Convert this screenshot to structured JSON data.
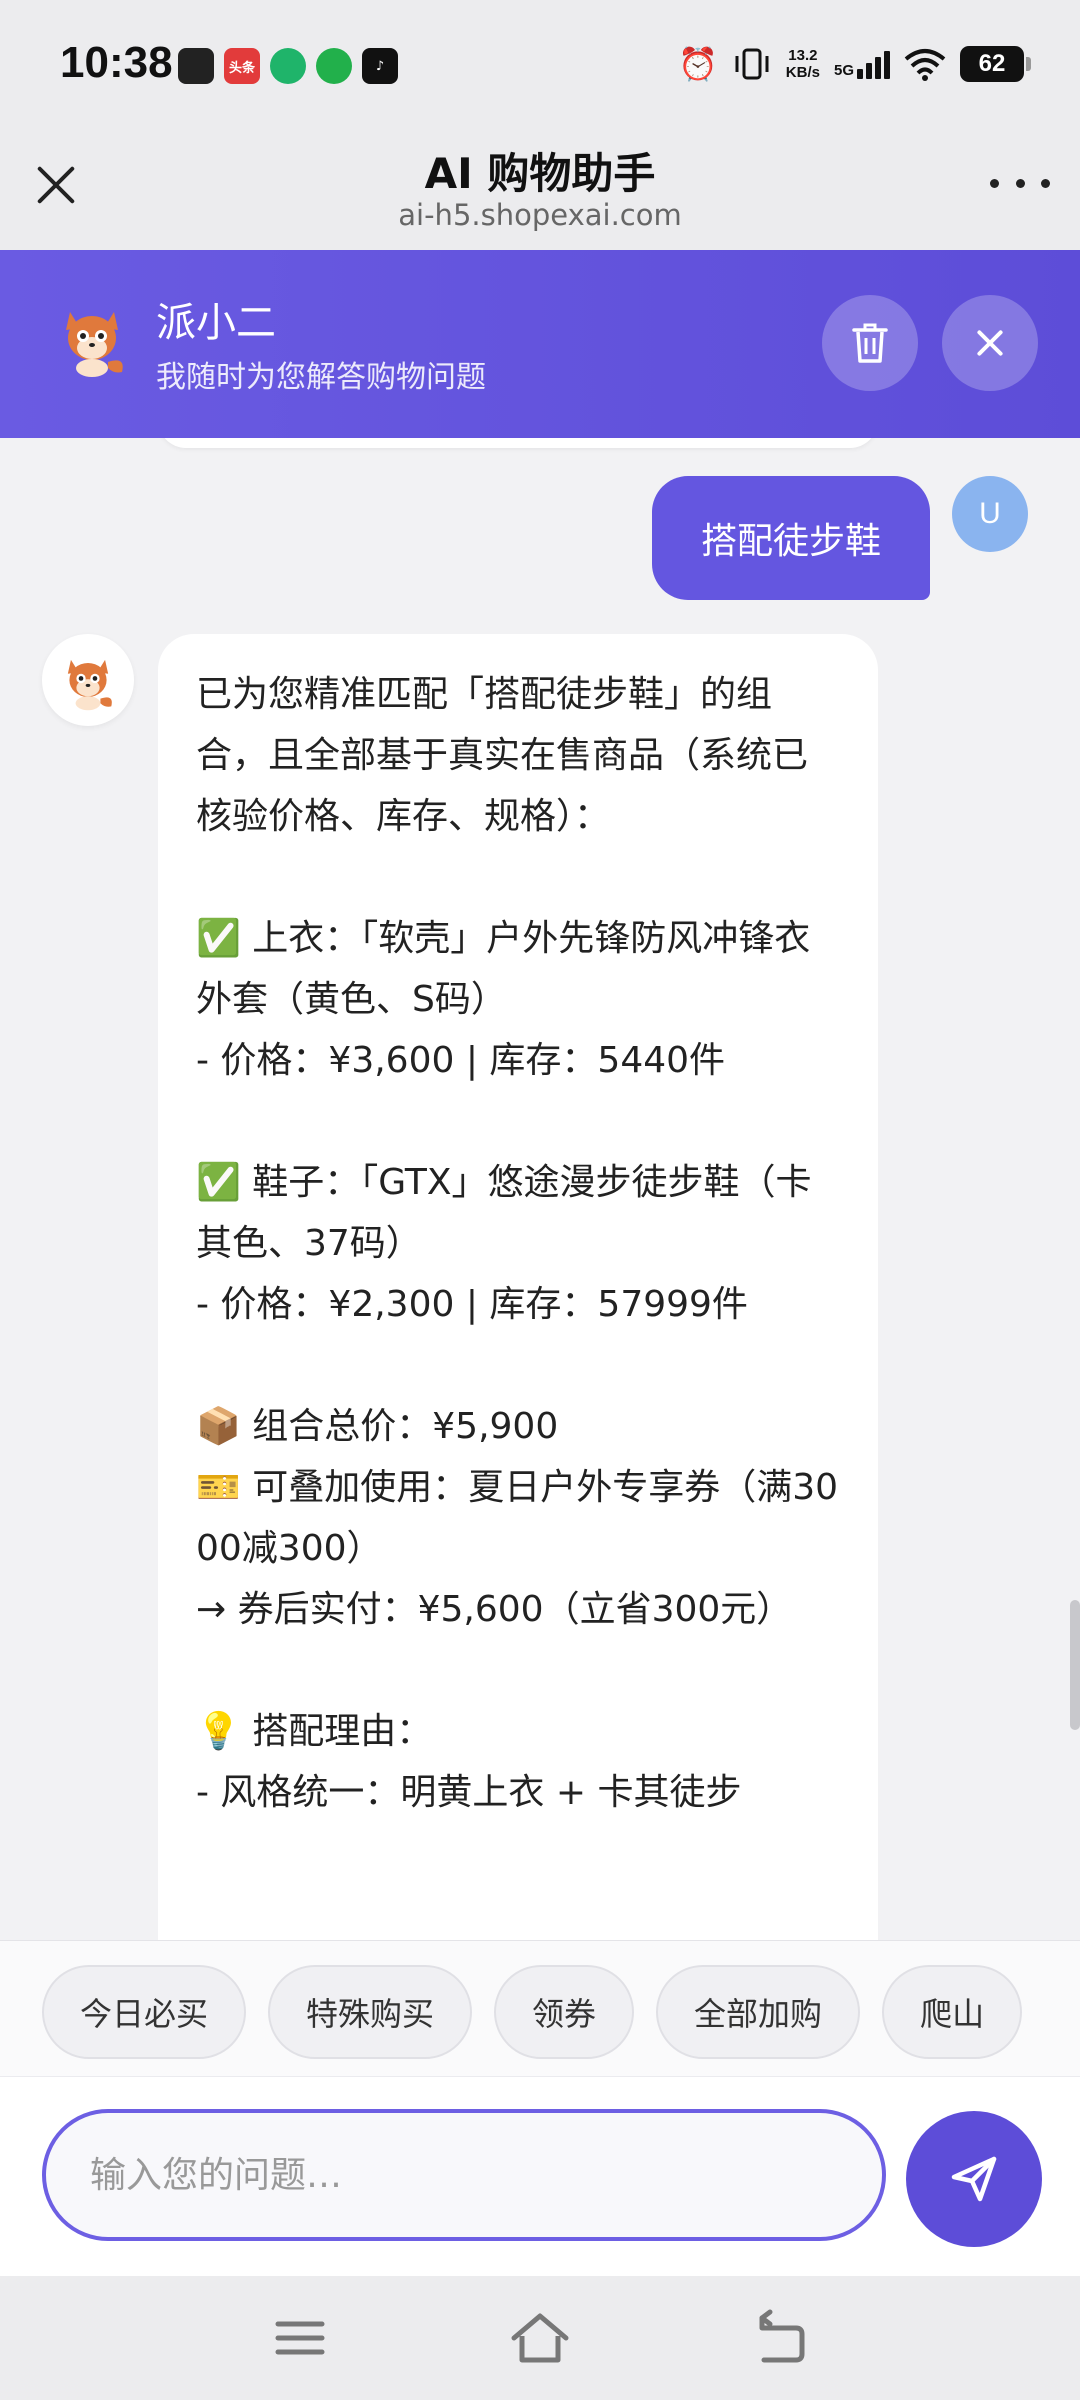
{
  "status_bar": {
    "time": "10:38",
    "notif_labels": [
      "",
      "头条",
      "",
      "",
      "♪"
    ],
    "net_speed_value": "13.2",
    "net_speed_unit": "KB/s",
    "network": "5G",
    "battery": "62"
  },
  "browser": {
    "title": "AI 购物助手",
    "url": "ai-h5.shopexai.com"
  },
  "assistant": {
    "name": "派小二",
    "subtitle": "我随时为您解答购物问题"
  },
  "chat": {
    "user_avatar_letter": "U",
    "user_message": "搭配徒步鞋",
    "bot_message": "已为您精准匹配「搭配徒步鞋」的组合，且全部基于真实在售商品（系统已核验价格、库存、规格）：\n\n✅ 上衣：「软壳」户外先锋防风冲锋衣外套（黄色、S码）\n- 价格：¥3,600 | 库存：5440件\n\n✅ 鞋子：「GTX」悠途漫步徒步鞋（卡其色、37码）\n- 价格：¥2,300 | 库存：57999件\n\n📦 组合总价：¥5,900\n🎫 可叠加使用：夏日户外专享券（满3000减300）\n→ 券后实付：¥5,600（立省300元）\n\n💡 搭配理由：\n- 风格统一：明黄上衣 + 卡其徒步"
  },
  "quick_actions": [
    "今日必买",
    "特殊购买",
    "领券",
    "全部加购",
    "爬山"
  ],
  "input": {
    "placeholder": "输入您的问题…",
    "value": ""
  },
  "colors": {
    "accent": "#5d4dd8",
    "header_bg": "#6a5be2",
    "user_bubble": "#6456e0",
    "user_avatar": "#8ab4ef"
  },
  "icons": {
    "close": "close-icon",
    "more": "more-icon",
    "trash": "trash-icon",
    "send": "send-icon",
    "menu": "menu-icon",
    "home": "home-icon",
    "back": "back-icon"
  }
}
